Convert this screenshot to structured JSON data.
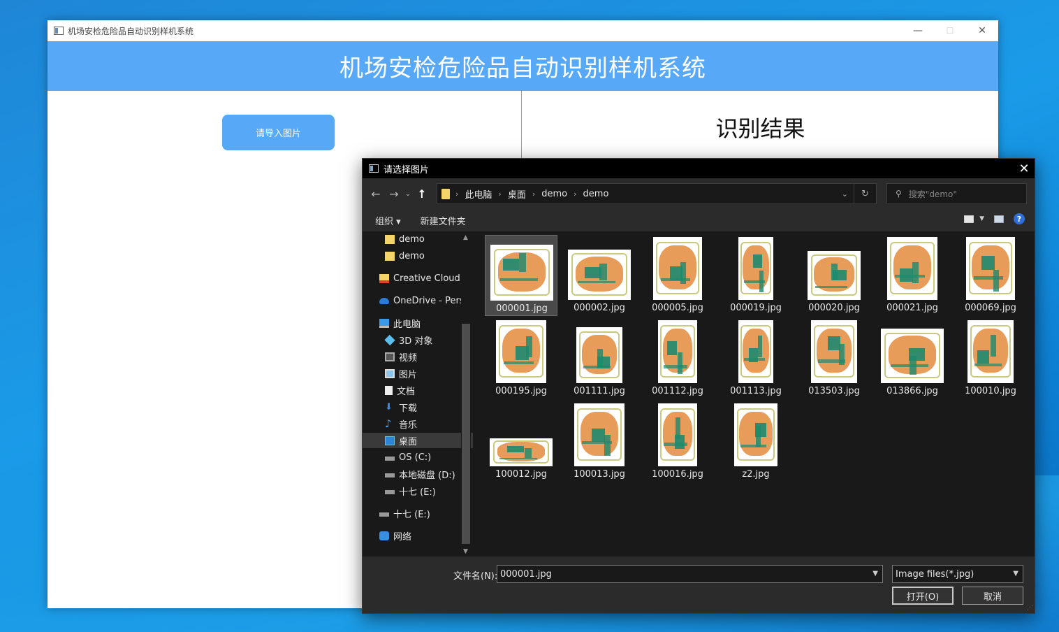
{
  "main_window": {
    "title": "机场安检危险品自动识别样机系统",
    "header": "机场安检危险品自动识别样机系统",
    "import_button": "请导入图片",
    "result_title": "识别结果",
    "caption_buttons": {
      "minimize": "—",
      "maximize": "☐",
      "close": "✕"
    }
  },
  "dialog": {
    "title": "请选择图片",
    "close": "✕",
    "breadcrumb": [
      "此电脑",
      "桌面",
      "demo",
      "demo"
    ],
    "search_placeholder": "搜索\"demo\"",
    "toolbar": {
      "organize": "组织 ▾",
      "new_folder": "新建文件夹",
      "help": "?"
    },
    "nav_items": [
      {
        "label": "demo",
        "icon": "folder-icon"
      },
      {
        "label": "demo",
        "icon": "folder-icon"
      },
      {
        "label": "Creative Cloud F",
        "icon": "creative-cloud-icon"
      },
      {
        "label": "OneDrive - Pers",
        "icon": "onedrive-icon"
      },
      {
        "label": "此电脑",
        "icon": "computer-icon"
      },
      {
        "label": "3D 对象",
        "icon": "3d-objects-icon"
      },
      {
        "label": "视频",
        "icon": "video-icon"
      },
      {
        "label": "图片",
        "icon": "pictures-icon"
      },
      {
        "label": "文档",
        "icon": "documents-icon"
      },
      {
        "label": "下载",
        "icon": "downloads-icon"
      },
      {
        "label": "音乐",
        "icon": "music-icon"
      },
      {
        "label": "桌面",
        "icon": "desktop-icon"
      },
      {
        "label": "OS (C:)",
        "icon": "drive-icon"
      },
      {
        "label": "本地磁盘 (D:)",
        "icon": "drive-icon"
      },
      {
        "label": "十七 (E:)",
        "icon": "drive-icon"
      },
      {
        "label": "十七 (E:)",
        "icon": "drive-icon"
      },
      {
        "label": "网络",
        "icon": "network-icon"
      }
    ],
    "files": [
      "000001.jpg",
      "000002.jpg",
      "000005.jpg",
      "000019.jpg",
      "000020.jpg",
      "000021.jpg",
      "000069.jpg",
      "000195.jpg",
      "001111.jpg",
      "001112.jpg",
      "001113.jpg",
      "013503.jpg",
      "013866.jpg",
      "100010.jpg",
      "100012.jpg",
      "100013.jpg",
      "100016.jpg",
      "z2.jpg"
    ],
    "selected_file": "000001.jpg",
    "filename_label": "文件名(N):",
    "filename_value": "000001.jpg",
    "filetype": "Image files(*.jpg)",
    "open_button": "打开(O)",
    "cancel_button": "取消"
  }
}
